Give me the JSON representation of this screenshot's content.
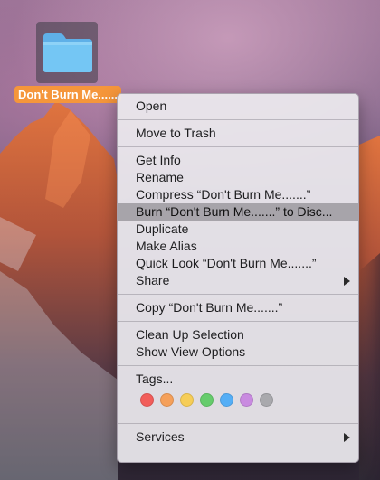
{
  "desktop": {
    "file": {
      "label": "Don't Burn Me......",
      "icon": "folder-icon",
      "folder_color": "#6ec1f2",
      "label_bg": "#f5963b"
    }
  },
  "context_menu": {
    "groups": [
      {
        "items": [
          {
            "label": "Open"
          }
        ]
      },
      {
        "items": [
          {
            "label": "Move to Trash"
          }
        ]
      },
      {
        "items": [
          {
            "label": "Get Info"
          },
          {
            "label": "Rename"
          },
          {
            "label": "Compress “Don't Burn Me.......”"
          },
          {
            "label": "Burn “Don't Burn Me.......” to Disc...",
            "highlighted": true
          },
          {
            "label": "Duplicate"
          },
          {
            "label": "Make Alias"
          },
          {
            "label": "Quick Look “Don't Burn Me.......”"
          },
          {
            "label": "Share",
            "submenu": true
          }
        ]
      },
      {
        "items": [
          {
            "label": "Copy “Don't Burn Me.......”"
          }
        ]
      },
      {
        "items": [
          {
            "label": "Clean Up Selection"
          },
          {
            "label": "Show View Options"
          }
        ]
      },
      {
        "items": [
          {
            "label": "Tags..."
          }
        ]
      },
      {
        "items": [
          {
            "label": "Services",
            "submenu": true
          }
        ]
      }
    ],
    "tag_colors": [
      {
        "name": "red-tag",
        "color": "#f25d5a"
      },
      {
        "name": "orange-tag",
        "color": "#f5a05a"
      },
      {
        "name": "yellow-tag",
        "color": "#f6cd57"
      },
      {
        "name": "green-tag",
        "color": "#66cc6c"
      },
      {
        "name": "blue-tag",
        "color": "#54aef6"
      },
      {
        "name": "purple-tag",
        "color": "#c98be0"
      },
      {
        "name": "gray-tag",
        "color": "#a9a9ad"
      }
    ],
    "highlight_color": "#a7a4aa"
  }
}
